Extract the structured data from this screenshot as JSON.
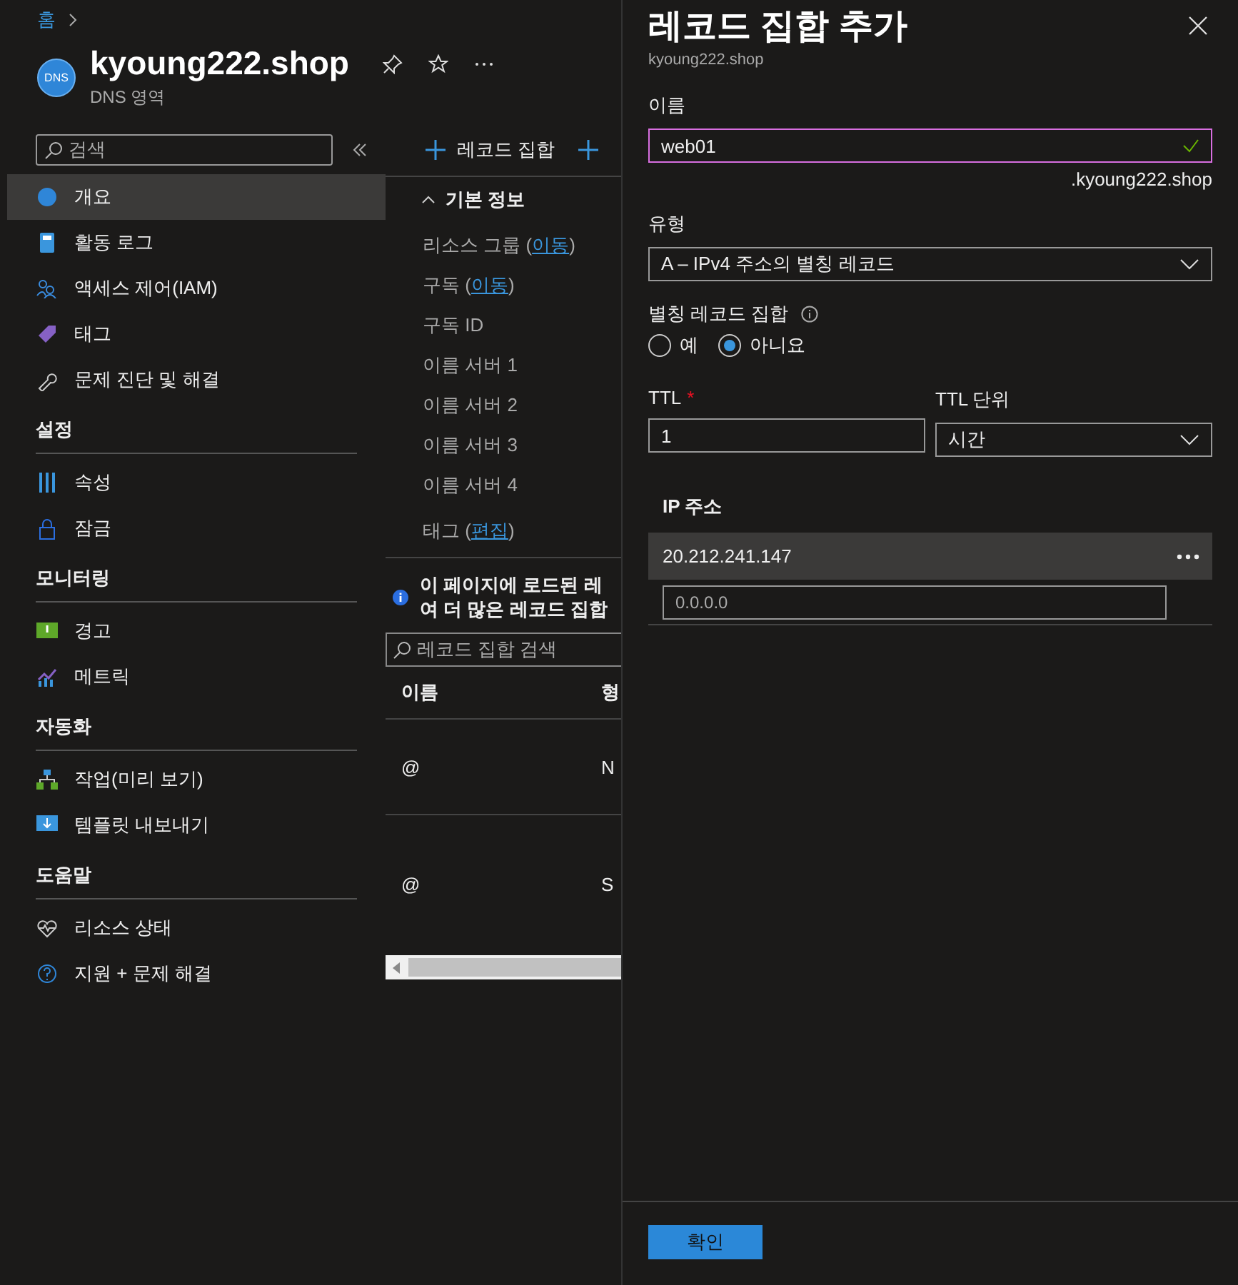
{
  "breadcrumb": {
    "items": [
      "홈"
    ]
  },
  "resource": {
    "title": "kyoung222.shop",
    "subtitle": "DNS 영역",
    "badge": "DNS"
  },
  "sidebar": {
    "search_placeholder": "검색",
    "sections": [
      {
        "items": [
          {
            "label": "개요",
            "selected": true
          },
          {
            "label": "활동 로그",
            "selected": false
          },
          {
            "label": "액세스 제어(IAM)",
            "selected": false
          },
          {
            "label": "태그",
            "selected": false
          },
          {
            "label": "문제 진단 및 해결",
            "selected": false
          }
        ]
      },
      {
        "heading": "설정",
        "items": [
          {
            "label": "속성",
            "selected": false
          },
          {
            "label": "잠금",
            "selected": false
          }
        ]
      },
      {
        "heading": "모니터링",
        "items": [
          {
            "label": "경고",
            "selected": false
          },
          {
            "label": "메트릭",
            "selected": false
          }
        ]
      },
      {
        "heading": "자동화",
        "items": [
          {
            "label": "작업(미리 보기)",
            "selected": false
          },
          {
            "label": "템플릿 내보내기",
            "selected": false
          }
        ]
      },
      {
        "heading": "도움말",
        "items": [
          {
            "label": "리소스 상태",
            "selected": false
          },
          {
            "label": "지원 + 문제 해결",
            "selected": false
          }
        ]
      }
    ]
  },
  "overview": {
    "toolbar": [
      {
        "label": "레코드 집합"
      }
    ],
    "essentials": {
      "heading": "기본 정보",
      "expanded": true,
      "fields": [
        {
          "label": "리소스 그룹 (",
          "link": "이동",
          "after": ")"
        },
        {
          "label": "구독 (",
          "link": "이동",
          "after": ")"
        },
        {
          "label": "구독 ID"
        },
        {
          "label": "이름 서버 1"
        },
        {
          "label": "이름 서버 2"
        },
        {
          "label": "이름 서버 3"
        },
        {
          "label": "이름 서버 4"
        }
      ],
      "tags": {
        "label": "태그 (",
        "link": "편집",
        "after": ")"
      }
    },
    "info": [
      "이 페이지에 로드된 레",
      "여 더 많은 레코드 집합"
    ],
    "search_placeholder": "레코드 집합 검색",
    "table": {
      "columns": [
        "이름",
        "형"
      ],
      "rows": [
        [
          "@",
          "N"
        ],
        [
          "@",
          "S"
        ]
      ]
    }
  },
  "panel": {
    "title": "레코드 집합 추가",
    "subtitle": "kyoung222.shop",
    "name": {
      "label": "이름",
      "value": "web01",
      "valid": true,
      "suffix": ".kyoung222.shop"
    },
    "type": {
      "label": "유형",
      "value": "A – IPv4 주소의 별칭 레코드"
    },
    "alias": {
      "label": "별칭 레코드 집합",
      "options": [
        {
          "label": "예",
          "selected": false
        },
        {
          "label": "아니요",
          "selected": true
        }
      ]
    },
    "ttl": {
      "label": "TTL",
      "required_mark": "*",
      "value": "1"
    },
    "ttl_unit": {
      "label": "TTL 단위",
      "value": "시간"
    },
    "ip": {
      "heading": "IP 주소",
      "rows": [
        "20.212.241.147"
      ],
      "placeholder": "0.0.0.0"
    },
    "confirm": "확인"
  }
}
